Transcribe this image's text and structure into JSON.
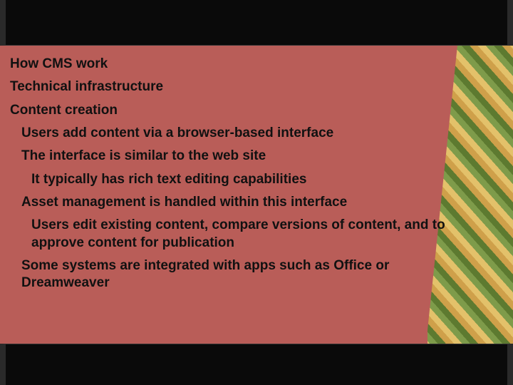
{
  "slide": {
    "lines": [
      {
        "text": "How CMS work",
        "level": 0
      },
      {
        "text": "Technical infrastructure",
        "level": 0
      },
      {
        "text": "Content creation",
        "level": 0
      },
      {
        "text": "Users add content via a browser-based interface",
        "level": 1
      },
      {
        "text": "The interface is similar to the web site",
        "level": 1
      },
      {
        "text": "It typically has rich text editing capabilities",
        "level": 2
      },
      {
        "text": "Asset management is handled within this interface",
        "level": 1
      },
      {
        "text": "Users edit existing content, compare versions of content, and to approve content for publication",
        "level": 2
      },
      {
        "text": "Some systems are integrated with apps such as Office or Dreamweaver",
        "level": 1
      }
    ]
  }
}
